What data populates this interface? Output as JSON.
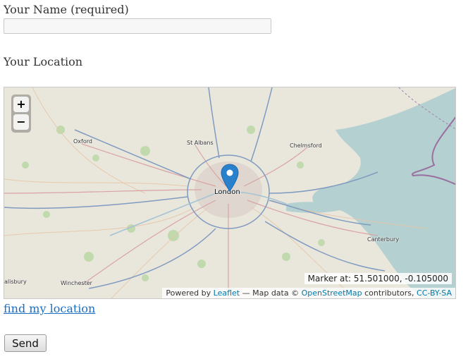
{
  "form": {
    "name_label": "Your Name (required)",
    "name_value": "",
    "location_label": "Your Location",
    "find_location_link": "find my location",
    "send_label": "Send"
  },
  "map": {
    "zoom_in": "+",
    "zoom_out": "−",
    "places": {
      "oxford": "Oxford",
      "st_albans": "St Albans",
      "chelmsford": "Chelmsford",
      "london": "London",
      "canterbury": "Canterbury",
      "salisbury": "alisbury",
      "winchester": "Winchester"
    },
    "marker_readout": "Marker at: 51.501000, -0.105000",
    "attribution": {
      "powered_by": "Powered by ",
      "leaflet": "Leaflet",
      "map_data": " — Map data © ",
      "osm": "OpenStreetMap",
      "contributors": " contributors, ",
      "license": "CC-BY-SA"
    },
    "colors": {
      "land": "#e9e6dc",
      "water": "#b5d0d0",
      "motorway": "#809bc0",
      "primary": "#d9a3a3",
      "marker": "#2a81cb"
    },
    "icons": [
      "zoom-in-icon",
      "zoom-out-icon",
      "map-marker-icon"
    ]
  }
}
